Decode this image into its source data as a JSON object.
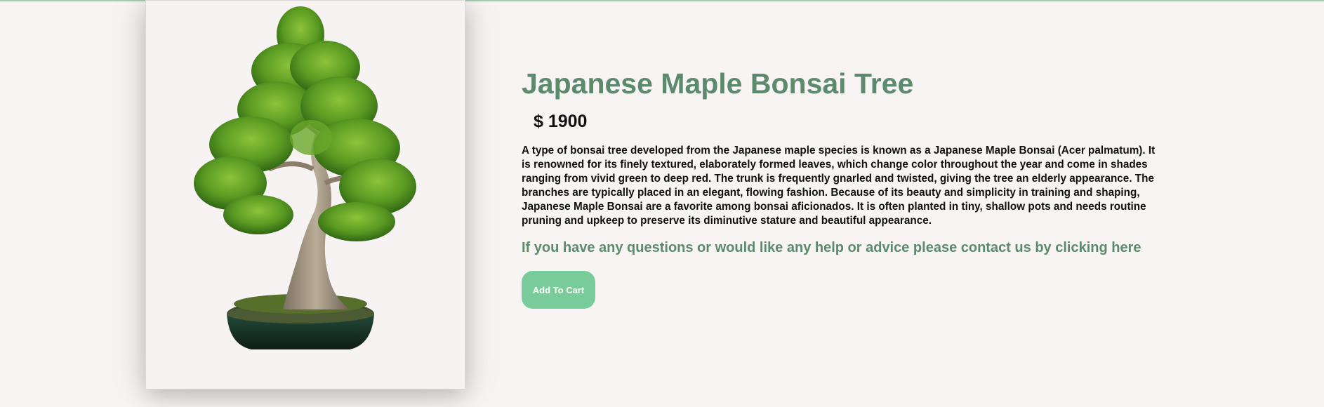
{
  "product": {
    "title": "Japanese Maple Bonsai Tree",
    "price": "$ 1900",
    "description": "A type of bonsai tree developed from the Japanese maple species is known as a Japanese Maple Bonsai (Acer palmatum). It is renowned for its finely textured, elaborately formed leaves, which change color throughout the year and come in shades ranging from vivid green to deep red. The trunk is frequently gnarled and twisted, giving the tree an elderly appearance. The branches are typically placed in an elegant, flowing fashion. Because of its beauty and simplicity in training and shaping, Japanese Maple Bonsai are a favorite among bonsai aficionados. It is often planted in tiny, shallow pots and needs routine pruning and upkeep to preserve its diminutive stature and beautiful appearance.",
    "image_subject": "bonsai-tree-image"
  },
  "contact_link": "If you have any questions or would like any help or advice please contact us by clicking here",
  "buttons": {
    "add_to_cart": "Add To Cart"
  },
  "colors": {
    "accent_green": "#5b8a6c",
    "button_green": "#79cc9a",
    "background": "#f8f4f4"
  }
}
